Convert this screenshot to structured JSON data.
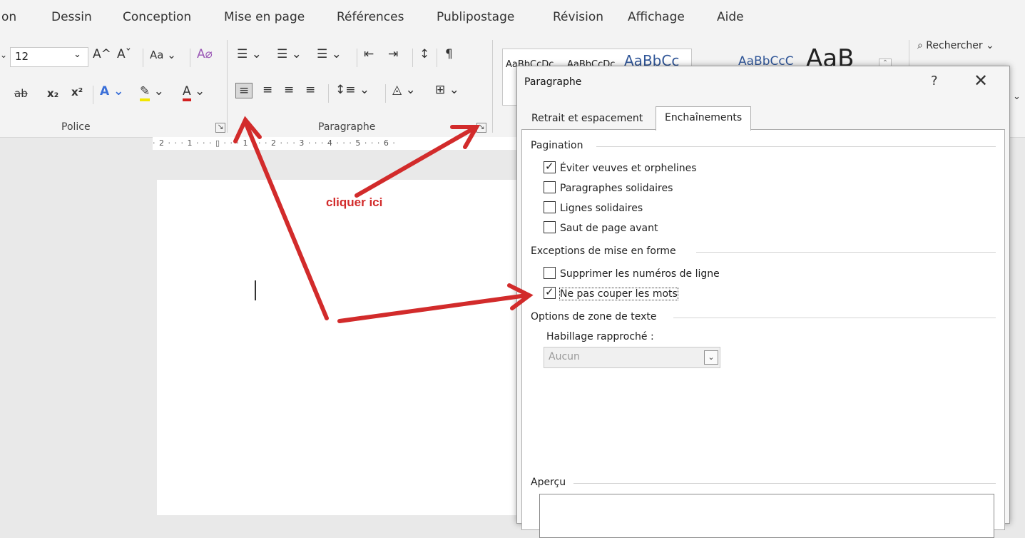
{
  "ribbon_tabs": [
    "on",
    "Dessin",
    "Conception",
    "Mise en page",
    "Références",
    "Publipostage",
    "Révision",
    "Affichage",
    "Aide"
  ],
  "ribbon": {
    "font_size": "12",
    "grow_font": "A^",
    "shrink_font": "Aˇ",
    "change_case": "Aa",
    "search_label": "Rechercher",
    "groups": {
      "police": "Police",
      "paragraphe": "Paragraphe"
    },
    "styles": [
      "AaBbCcDc",
      "AaBbCcDc",
      "AaBbCc",
      "AaBbCcC",
      "AaB"
    ]
  },
  "ruler_text": "· 2 · · · 1 · · · ▯ · · · 1 · · · 2 · · · 3 · · · 4 · · · 5 · · · 6 ·",
  "annotation": {
    "text": "cliquer ici",
    "color": "#d22b2b"
  },
  "dialog": {
    "title": "Paragraphe",
    "help": "?",
    "close": "✕",
    "tabs": [
      "Retrait et espacement",
      "Enchaînements"
    ],
    "active_tab": "Enchaînements",
    "sections": {
      "pagination": {
        "title": "Pagination",
        "options": [
          {
            "label": "Éviter veuves et orphelines",
            "checked": true
          },
          {
            "label": "Paragraphes solidaires",
            "checked": false
          },
          {
            "label": "Lignes solidaires",
            "checked": false
          },
          {
            "label": "Saut de page avant",
            "checked": false
          }
        ]
      },
      "exceptions": {
        "title": "Exceptions de mise en forme",
        "options": [
          {
            "label": "Supprimer les numéros de ligne",
            "checked": false
          },
          {
            "label": "Ne pas couper les mots",
            "checked": true
          }
        ]
      },
      "textbox": {
        "title": "Options de zone de texte",
        "wrap_label": "Habillage rapproché :",
        "wrap_value": "Aucun"
      },
      "preview": {
        "title": "Aperçu"
      }
    }
  }
}
